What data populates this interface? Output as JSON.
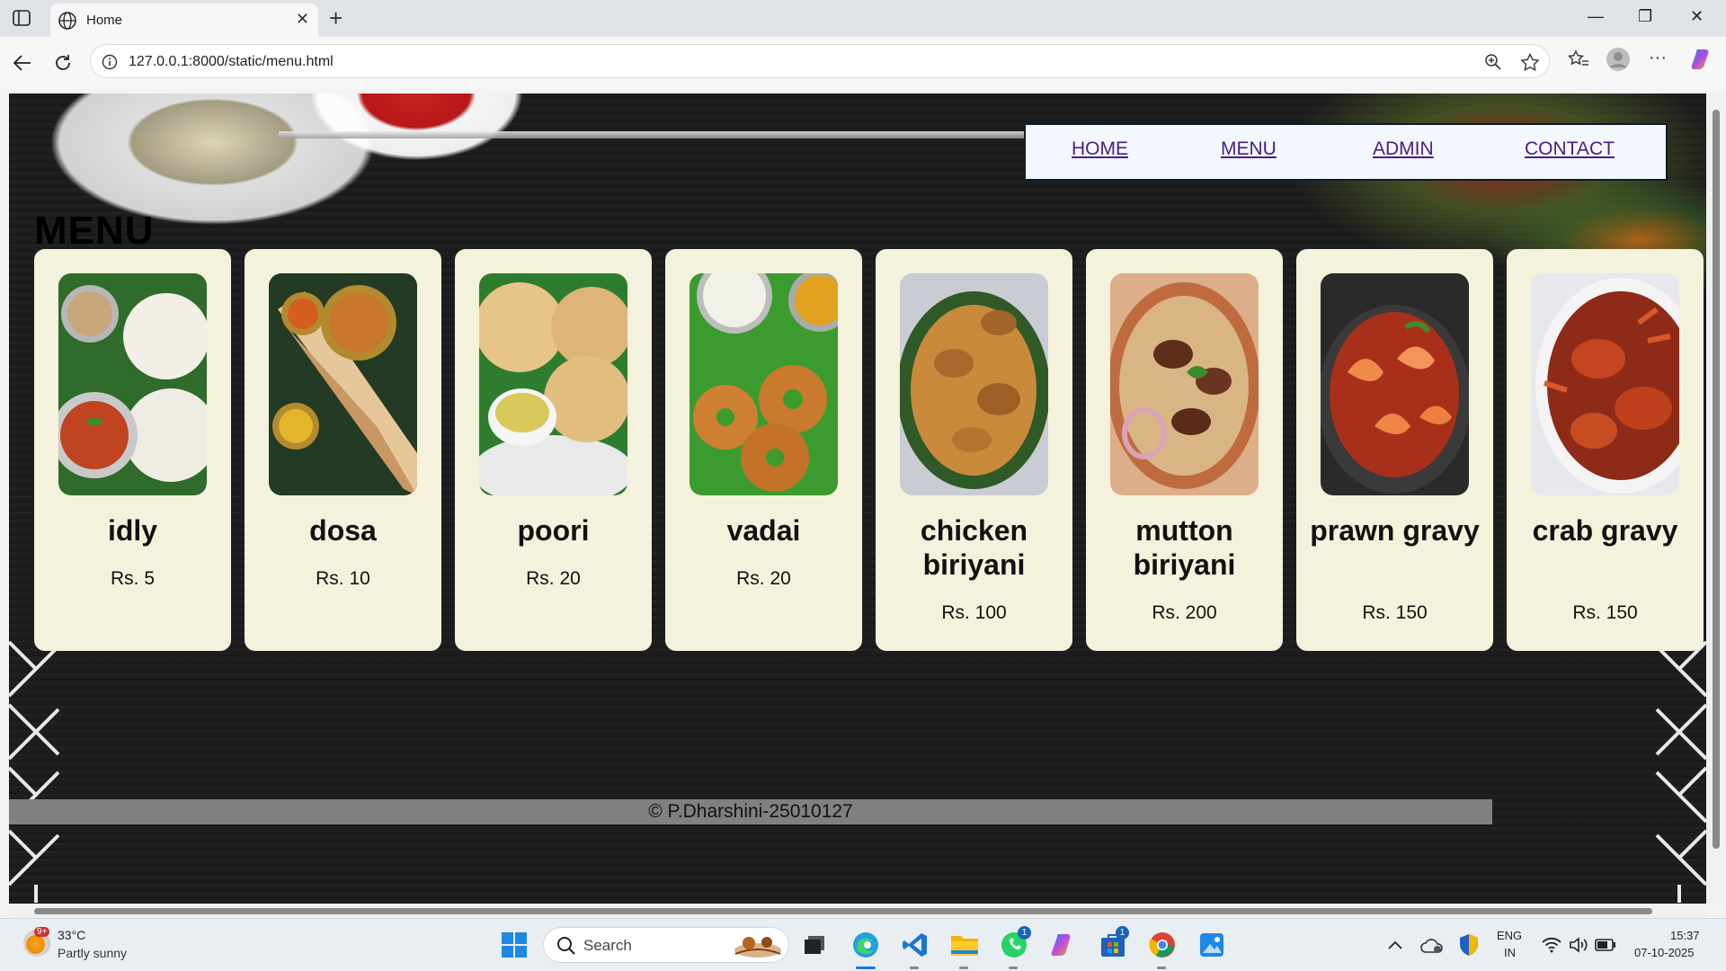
{
  "browser": {
    "tab_title": "Home",
    "url": "127.0.0.1:8000/static/menu.html",
    "new_tab_symbol": "+",
    "close_symbol": "✕",
    "window_controls": [
      "—",
      "❐",
      "✕"
    ]
  },
  "nav": {
    "home": "HOME",
    "menu": "MENU",
    "admin": "ADMIN",
    "contact": "CONTACT"
  },
  "page_title": "MENU",
  "items": [
    {
      "name": "idly",
      "price": "Rs. 5",
      "photo": "idly-photo"
    },
    {
      "name": "dosa",
      "price": "Rs. 10",
      "photo": "dosa-photo"
    },
    {
      "name": "poori",
      "price": "Rs. 20",
      "photo": "poori-photo"
    },
    {
      "name": "vadai",
      "price": "Rs. 20",
      "photo": "vadai-photo"
    },
    {
      "name": "chicken biriyani",
      "price": "Rs. 100",
      "photo": "chicken-biriyani-photo"
    },
    {
      "name": "mutton biriyani",
      "price": "Rs. 200",
      "photo": "mutton-biriyani-photo"
    },
    {
      "name": "prawn gravy",
      "price": "Rs. 150",
      "photo": "prawn-gravy-photo"
    },
    {
      "name": "crab gravy",
      "price": "Rs. 150",
      "photo": "crab-gravy-photo"
    }
  ],
  "footer": "© P.Dharshini-25010127",
  "taskbar": {
    "weather_temp": "33°C",
    "weather_desc": "Partly sunny",
    "weather_badge": "9+",
    "search_label": "Search",
    "whatsapp_badge": "1",
    "store_badge": "1",
    "language": "ENG",
    "region": "IN",
    "time": "15:37",
    "date": "07-10-2025"
  },
  "colors": {
    "card_bg": "#f4f2dc",
    "nav_link": "#4b1d86",
    "footer_bar": "#808080"
  }
}
